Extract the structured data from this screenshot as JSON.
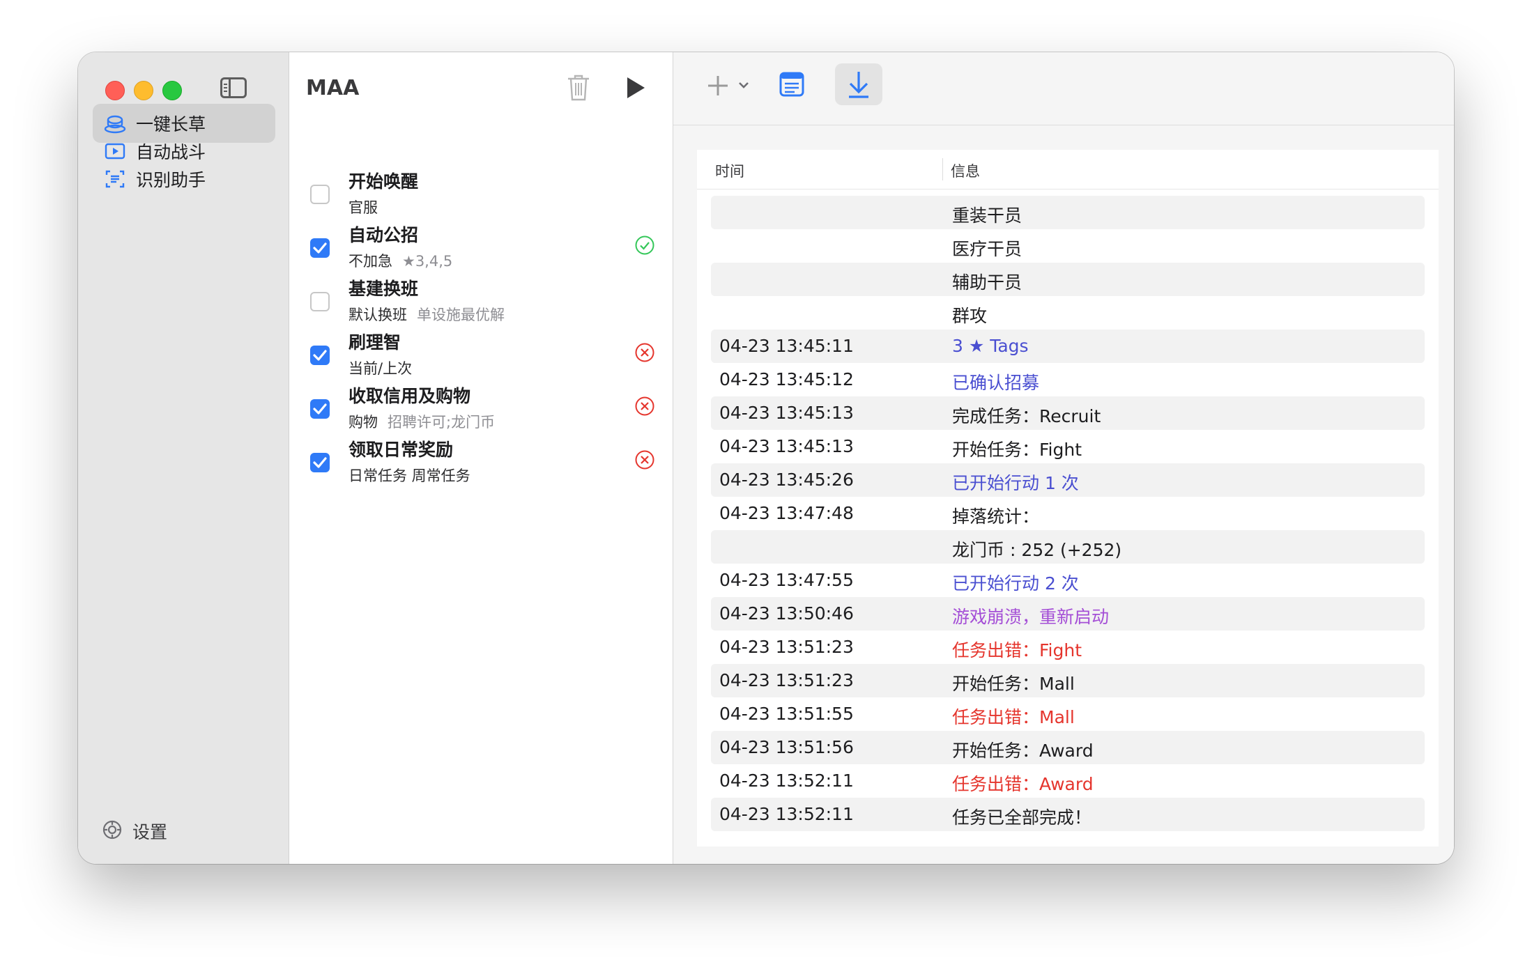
{
  "sidebar": {
    "items": [
      {
        "label": "一键长草",
        "icon": "coffee-cup-icon",
        "active": true
      },
      {
        "label": "自动战斗",
        "icon": "play-rectangle-icon",
        "active": false
      },
      {
        "label": "识别助手",
        "icon": "text-scan-icon",
        "active": false
      }
    ],
    "settings_label": "设置"
  },
  "tasks": {
    "title": "MAA",
    "items": [
      {
        "name": "开始唤醒",
        "sub": "官服",
        "sub_dim": "",
        "checked": false,
        "status": ""
      },
      {
        "name": "自动公招",
        "sub": "不加急",
        "sub_dim": "★3,4,5",
        "checked": true,
        "status": "success"
      },
      {
        "name": "基建换班",
        "sub": "默认换班",
        "sub_dim": "单设施最优解",
        "checked": false,
        "status": ""
      },
      {
        "name": "刷理智",
        "sub": "当前/上次",
        "sub_dim": "",
        "checked": true,
        "status": "error"
      },
      {
        "name": "收取信用及购物",
        "sub": "购物",
        "sub_dim": "招聘许可;龙门币",
        "checked": true,
        "status": "error"
      },
      {
        "name": "领取日常奖励",
        "sub": "日常任务 周常任务",
        "sub_dim": "",
        "checked": true,
        "status": "error"
      }
    ]
  },
  "log": {
    "col_time": "时间",
    "col_info": "信息",
    "rows": [
      {
        "time": "",
        "msg": "重装干员",
        "color": "#1d1d1f"
      },
      {
        "time": "",
        "msg": "医疗干员",
        "color": "#1d1d1f"
      },
      {
        "time": "",
        "msg": "辅助干员",
        "color": "#1d1d1f"
      },
      {
        "time": "",
        "msg": "群攻",
        "color": "#1d1d1f"
      },
      {
        "time": "04-23 13:45:11",
        "msg": "3 ★ Tags",
        "color": "#4a4fd1"
      },
      {
        "time": "04-23 13:45:12",
        "msg": "已确认招募",
        "color": "#4a4fd1"
      },
      {
        "time": "04-23 13:45:13",
        "msg": "完成任务：Recruit",
        "color": "#1d1d1f"
      },
      {
        "time": "04-23 13:45:13",
        "msg": "开始任务：Fight",
        "color": "#1d1d1f"
      },
      {
        "time": "04-23 13:45:26",
        "msg": "已开始行动 1 次",
        "color": "#4a4fd1"
      },
      {
        "time": "04-23 13:47:48",
        "msg": "掉落统计：",
        "color": "#1d1d1f"
      },
      {
        "time": "",
        "msg": "龙门币 : 252 (+252)",
        "color": "#1d1d1f"
      },
      {
        "time": "04-23 13:47:55",
        "msg": "已开始行动 2 次",
        "color": "#4a4fd1"
      },
      {
        "time": "04-23 13:50:46",
        "msg": "游戏崩溃，重新启动",
        "color": "#a44ed6"
      },
      {
        "time": "04-23 13:51:23",
        "msg": "任务出错：Fight",
        "color": "#e5352d"
      },
      {
        "time": "04-23 13:51:23",
        "msg": "开始任务：Mall",
        "color": "#1d1d1f"
      },
      {
        "time": "04-23 13:51:55",
        "msg": "任务出错：Mall",
        "color": "#e5352d"
      },
      {
        "time": "04-23 13:51:56",
        "msg": "开始任务：Award",
        "color": "#1d1d1f"
      },
      {
        "time": "04-23 13:52:11",
        "msg": "任务出错：Award",
        "color": "#e5352d"
      },
      {
        "time": "04-23 13:52:11",
        "msg": "任务已全部完成！",
        "color": "#1d1d1f"
      }
    ]
  },
  "colors": {
    "accent": "#2f7af7",
    "success": "#34c759",
    "error": "#e5352d",
    "info": "#4a4fd1",
    "warning_purple": "#a44ed6"
  }
}
